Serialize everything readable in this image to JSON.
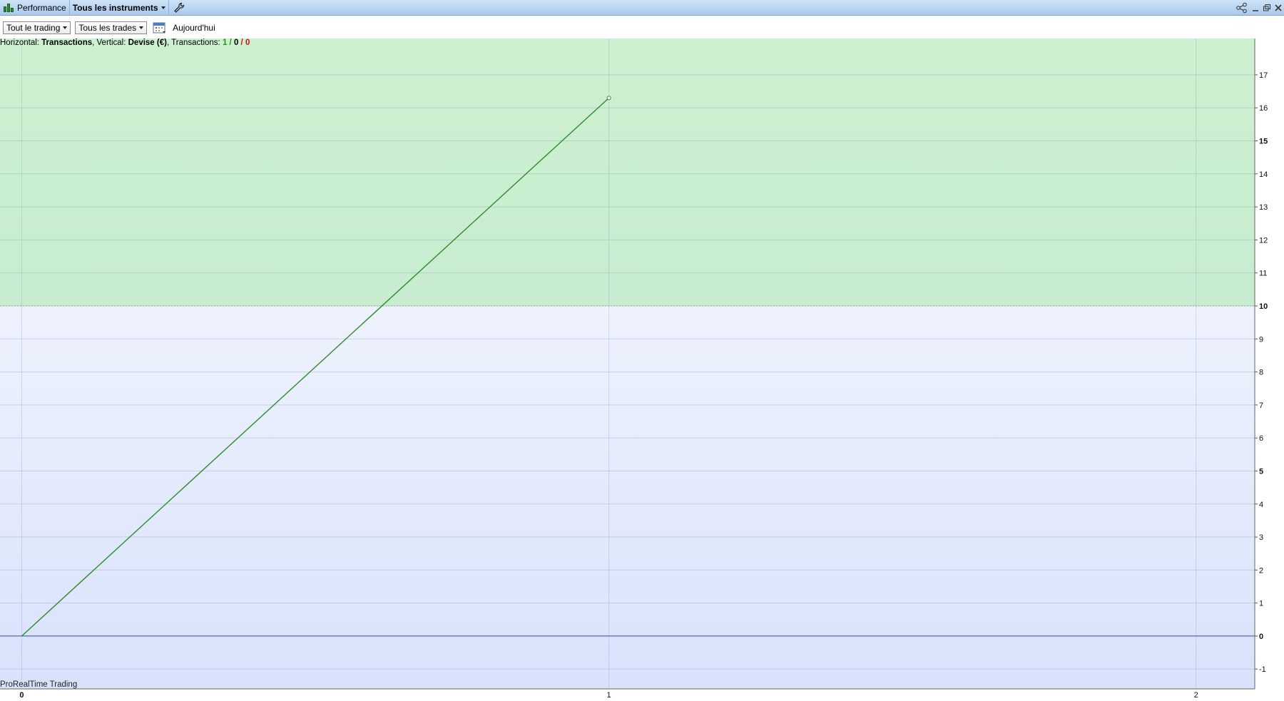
{
  "titlebar": {
    "app_label": "Performance",
    "instrument_label": "Tous les instruments"
  },
  "toolbar": {
    "trading_filter": "Tout le trading",
    "trades_filter": "Tous les trades",
    "date_label": "Aujourd'hui"
  },
  "chart_info": {
    "horizontal_prefix": "Horizontal: ",
    "horizontal_value": "Transactions",
    "vertical_prefix": ", Vertical: ",
    "vertical_value": "Devise (€)",
    "transactions_prefix": ", Transactions: ",
    "wins": "1",
    "sep1": " / ",
    "neutral": "0",
    "sep2": " / ",
    "losses": "0"
  },
  "brand": "ProRealTime Trading",
  "colors": {
    "profit_zone": "#c8ecd0",
    "neutral_zone": "#e6ecfb",
    "line": "#2e8b2e",
    "zero_line": "#3a4fa8"
  },
  "chart_data": {
    "type": "line",
    "x": [
      0,
      1
    ],
    "series": [
      {
        "values": [
          0,
          16.3
        ]
      }
    ],
    "xlim": [
      -0.037,
      2.1
    ],
    "ylim": [
      -1.6,
      18.1
    ],
    "x_ticks": [
      "0",
      "1",
      "2"
    ],
    "y_ticks": [
      "-1",
      "0",
      "1",
      "2",
      "3",
      "4",
      "5",
      "6",
      "7",
      "8",
      "9",
      "10",
      "11",
      "12",
      "13",
      "14",
      "15",
      "16",
      "17"
    ],
    "bold_y_ticks": [
      "0",
      "5",
      "10",
      "15"
    ],
    "profit_threshold": 10,
    "grid": true
  }
}
